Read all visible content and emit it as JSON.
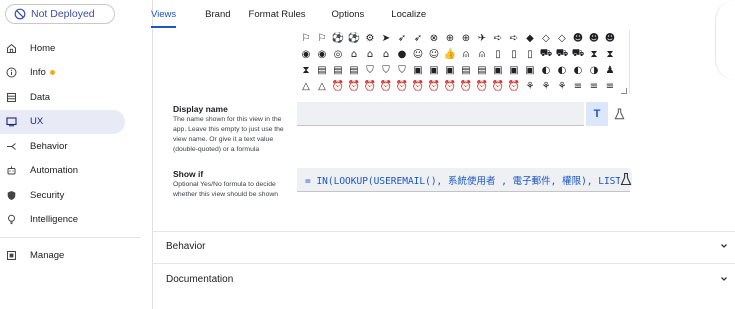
{
  "deploy": {
    "label": "Not Deployed"
  },
  "nav": {
    "home": "Home",
    "info": "Info",
    "data": "Data",
    "ux": "UX",
    "behavior": "Behavior",
    "automation": "Automation",
    "security": "Security",
    "intelligence": "Intelligence",
    "manage": "Manage"
  },
  "tabs": [
    "Views",
    "Brand",
    "Format Rules",
    "Options",
    "Localize"
  ],
  "icon_rows": [
    [
      "⚐",
      "⚐",
      "⚽",
      "⚽",
      "⚙",
      "➤",
      "➶",
      "➶",
      "⊗",
      "⊕",
      "⊕",
      "✈",
      "➪",
      "➪",
      "◆",
      "◇",
      "◇",
      "☻",
      "☻",
      "☻"
    ],
    [
      "◉",
      "◉",
      "◎",
      "⌂",
      "⌂",
      "⌂",
      "●",
      "☺",
      "☺",
      "👍",
      "⍝",
      "⍝",
      "▯",
      "▯",
      "▯",
      "⛟",
      "⛟",
      "⛟",
      "⧗",
      "⧗"
    ],
    [
      "⧗",
      "▤",
      "▤",
      "▤",
      "⛉",
      "⛉",
      "⛉",
      "▣",
      "▣",
      "▣",
      "▤",
      "▤",
      "▣",
      "▣",
      "▣",
      "◐",
      "◐",
      "◐",
      "◑",
      "♟"
    ],
    [
      "△",
      "△",
      "⏰",
      "⏰",
      "⏰",
      "⏰",
      "⏰",
      "⏰",
      "⏰",
      "⏰",
      "⏰",
      "⏰",
      "⏰",
      "⏰",
      "⚘",
      "⚘",
      "⚘",
      "≡",
      "≡",
      "≡"
    ]
  ],
  "display_name": {
    "label": "Display name",
    "help": "The name shown for this view in the app. Leave this empty to just use the view name. Or give it a text value (double-quoted) or a formula",
    "value": ""
  },
  "show_if": {
    "label": "Show if",
    "help": "Optional Yes/No formula to decide whether this view should be shown",
    "value": "= IN(LOOKUP(USEREMAIL(), 系統使用者 , 電子郵件, 權限), LIST"
  },
  "sections": {
    "behavior": "Behavior",
    "documentation": "Documentation"
  },
  "colors": {
    "accent": "#1a56c4",
    "active_bg": "#e8eaf6",
    "info_dot": "#f9a825"
  }
}
